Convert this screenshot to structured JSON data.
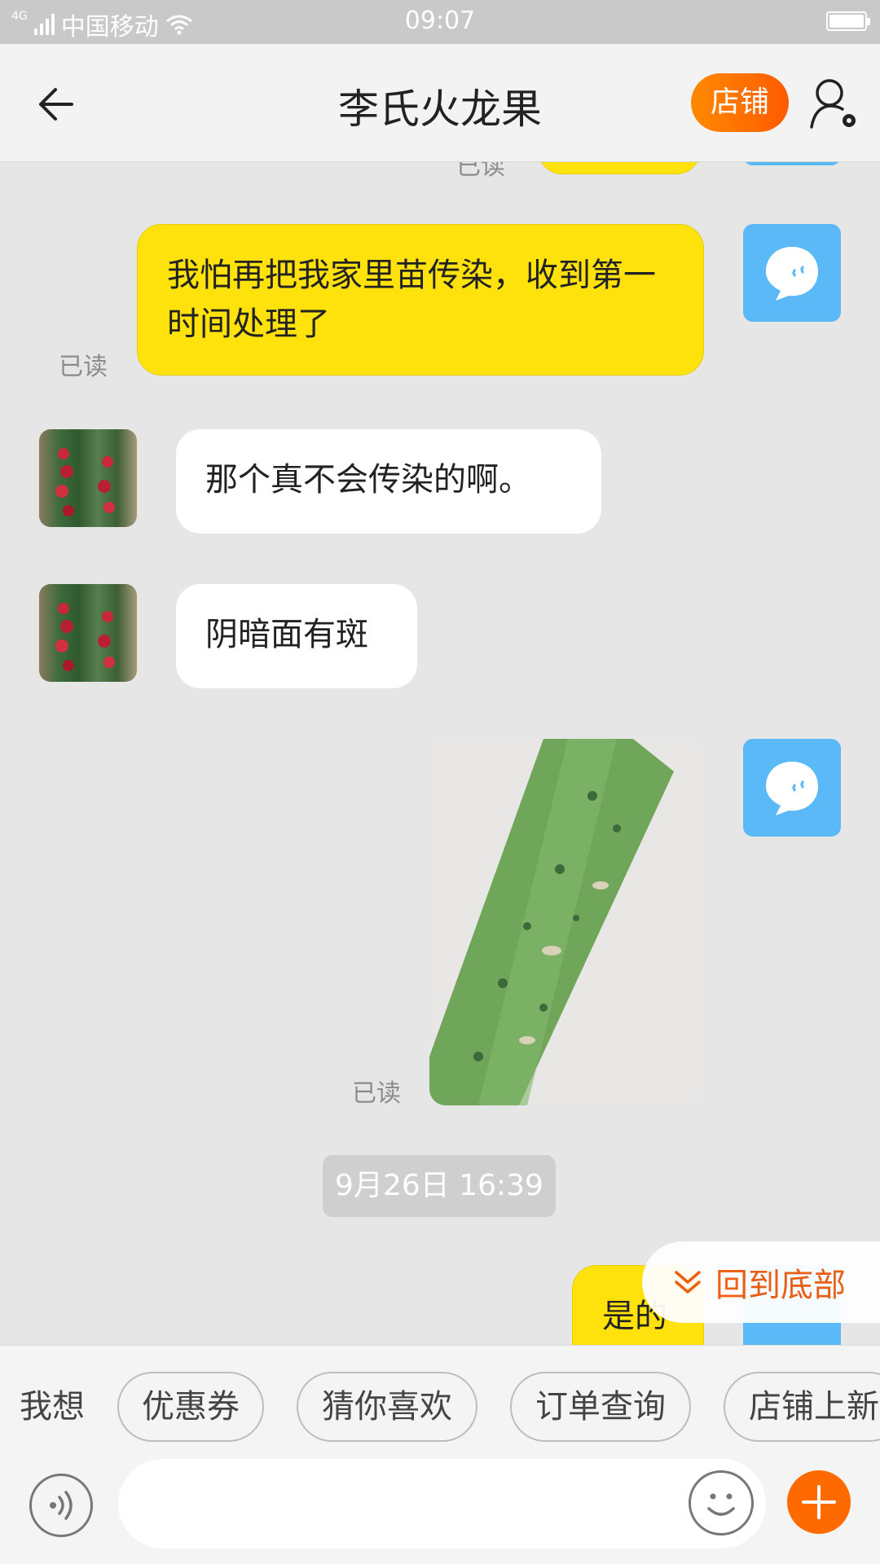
{
  "status_bar": {
    "network": "4G",
    "carrier": "中国移动",
    "time": "09:07"
  },
  "header": {
    "title": "李氏火龙果",
    "shop_button": "店铺"
  },
  "messages": [
    {
      "sender": "me",
      "type": "text",
      "text": "我怕再把我家里苗传染，收到第一时间处理了",
      "read": "已读"
    },
    {
      "sender": "shop",
      "type": "text",
      "text": "那个真不会传染的啊。"
    },
    {
      "sender": "shop",
      "type": "text",
      "text": "阴暗面有斑"
    },
    {
      "sender": "me",
      "type": "image",
      "read": "已读"
    },
    {
      "sender": "system",
      "type": "timestamp",
      "text": "9月26日 16:39"
    },
    {
      "sender": "me",
      "type": "text",
      "text": "是的"
    }
  ],
  "scroll_to_bottom": "回到底部",
  "quick_actions": {
    "label": "我想",
    "chips": [
      "优惠券",
      "猜你喜欢",
      "订单查询",
      "店铺上新"
    ]
  },
  "input": {
    "placeholder": ""
  },
  "colors": {
    "accent_orange": "#ff6a00",
    "my_bubble": "#ffe20c",
    "my_avatar": "#5cb9f8"
  }
}
